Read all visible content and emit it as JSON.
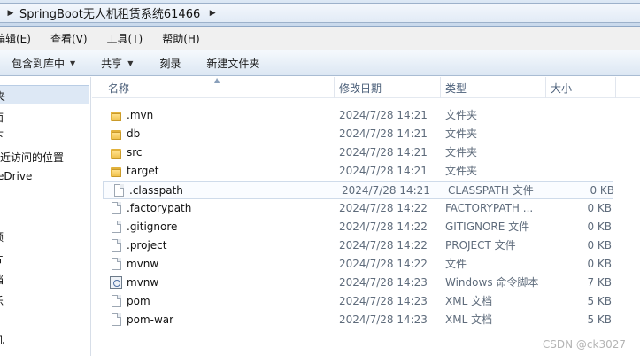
{
  "address": {
    "path_segment": "SpringBoot无人机租赁系统61466"
  },
  "menu": [
    {
      "label": "编辑(E)"
    },
    {
      "label": "查看(V)"
    },
    {
      "label": "工具(T)"
    },
    {
      "label": "帮助(H)"
    }
  ],
  "toolbar": {
    "include_library": "包含到库中",
    "share": "共享",
    "burn": "刻录",
    "new_folder": "新建文件夹"
  },
  "nav": {
    "items": [
      "夹",
      "面",
      "最近访问的位置",
      "eDrive",
      "频",
      "片",
      "档",
      "乐",
      "机"
    ]
  },
  "columns": {
    "name": "名称",
    "date": "修改日期",
    "type": "类型",
    "size": "大小"
  },
  "files": [
    {
      "name": ".mvn",
      "date": "2024/7/28 14:21",
      "type": "文件夹",
      "size": "",
      "icon": "folder-icon"
    },
    {
      "name": "db",
      "date": "2024/7/28 14:21",
      "type": "文件夹",
      "size": "",
      "icon": "folder-icon"
    },
    {
      "name": "src",
      "date": "2024/7/28 14:21",
      "type": "文件夹",
      "size": "",
      "icon": "folder-icon"
    },
    {
      "name": "target",
      "date": "2024/7/28 14:21",
      "type": "文件夹",
      "size": "",
      "icon": "folder-icon"
    },
    {
      "name": ".classpath",
      "date": "2024/7/28 14:21",
      "type": "CLASSPATH 文件",
      "size": "0 KB",
      "icon": "file-icon",
      "selected": true
    },
    {
      "name": ".factorypath",
      "date": "2024/7/28 14:22",
      "type": "FACTORYPATH ...",
      "size": "0 KB",
      "icon": "file-icon"
    },
    {
      "name": ".gitignore",
      "date": "2024/7/28 14:22",
      "type": "GITIGNORE 文件",
      "size": "0 KB",
      "icon": "file-icon"
    },
    {
      "name": ".project",
      "date": "2024/7/28 14:22",
      "type": "PROJECT 文件",
      "size": "0 KB",
      "icon": "file-icon"
    },
    {
      "name": "mvnw",
      "date": "2024/7/28 14:22",
      "type": "文件",
      "size": "0 KB",
      "icon": "file-icon"
    },
    {
      "name": "mvnw",
      "date": "2024/7/28 14:23",
      "type": "Windows 命令脚本",
      "size": "7 KB",
      "icon": "script-icon"
    },
    {
      "name": "pom",
      "date": "2024/7/28 14:23",
      "type": "XML 文档",
      "size": "5 KB",
      "icon": "file-icon"
    },
    {
      "name": "pom-war",
      "date": "2024/7/28 14:23",
      "type": "XML 文档",
      "size": "5 KB",
      "icon": "file-icon"
    }
  ],
  "watermark": "CSDN @ck3027"
}
